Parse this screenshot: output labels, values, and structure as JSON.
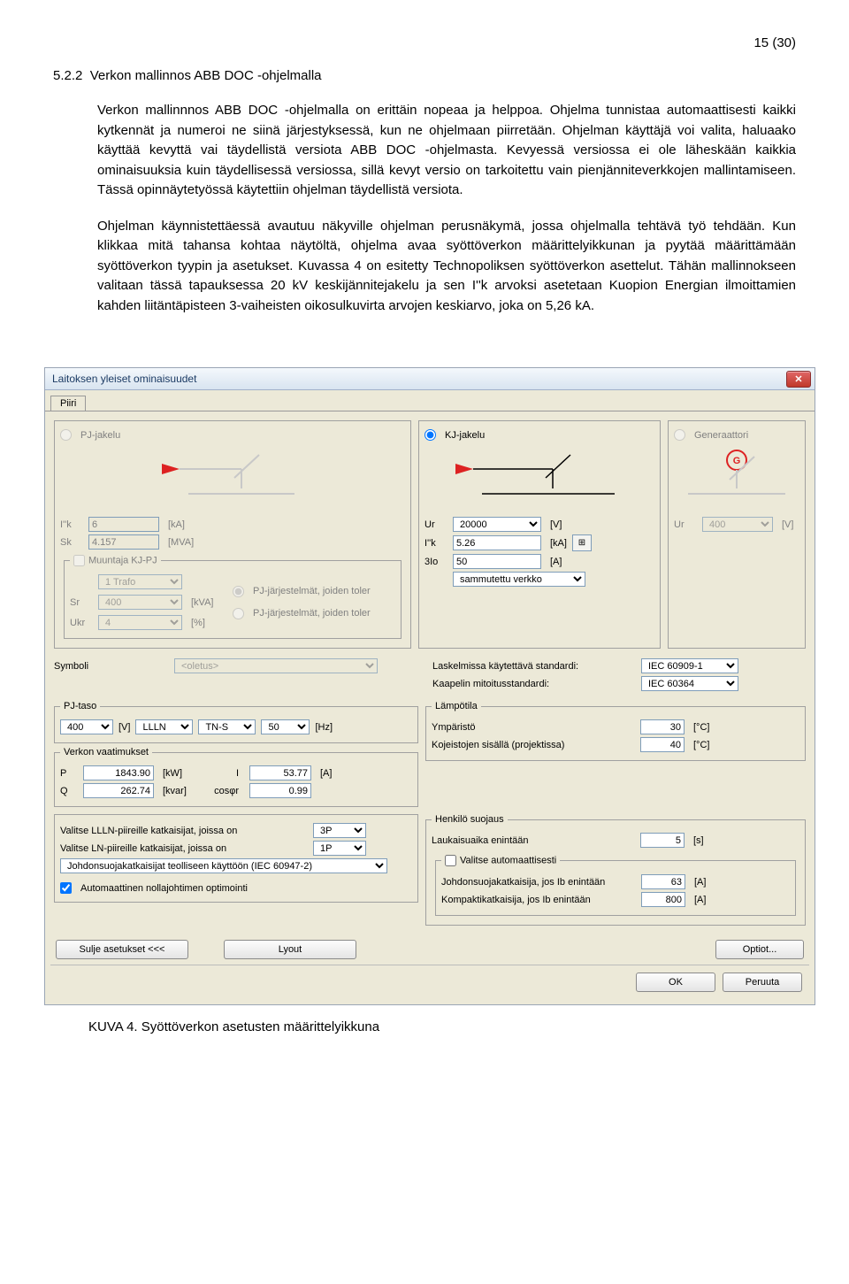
{
  "page": {
    "page_number": "15 (30)",
    "section_number": "5.2.2",
    "section_title": "Verkon mallinnos ABB DOC -ohjelmalla",
    "paragraphs": [
      "Verkon mallinnnos ABB DOC -ohjelmalla on erittäin nopeaa ja helppoa. Ohjelma tunnistaa automaattisesti kaikki kytkennät ja numeroi ne siinä järjestyksessä, kun ne ohjelmaan piirretään. Ohjelman käyttäjä voi valita, haluaako käyttää kevyttä vai täydellistä versiota ABB DOC -ohjelmasta. Kevyessä versiossa ei ole läheskään kaikkia ominaisuuksia kuin täydellisessä versiossa, sillä kevyt versio on tarkoitettu vain pienjänniteverkkojen mallintamiseen. Tässä opinnäytetyössä käytettiin ohjelman täydellistä versiota.",
      "Ohjelman käynnistettäessä avautuu näkyville ohjelman perusnäkymä, jossa ohjelmalla tehtävä työ tehdään. Kun klikkaa mitä tahansa kohtaa näytöltä, ohjelma avaa syöttöverkon määrittelyikkunan ja pyytää määrittämään syöttöverkon tyypin ja asetukset. Kuvassa 4 on esitetty Technopoliksen syöttöverkon asettelut. Tähän mallinnokseen valitaan tässä tapauksessa 20 kV keskijännitejakelu ja sen I''k arvoksi asetetaan Kuopion Energian ilmoittamien kahden liitäntäpisteen 3-vaiheisten oikosulkuvirta arvojen keskiarvo, joka on 5,26 kA."
    ],
    "caption": "KUVA 4. Syöttöverkon asetusten määrittelyikkuna"
  },
  "dialog": {
    "title": "Laitoksen yleiset ominaisuudet",
    "tab": "Piiri",
    "source": {
      "pj_label": "PJ-jakelu",
      "kj_label": "KJ-jakelu",
      "gen_label": "Generaattori",
      "gen_symbol": "G"
    },
    "pj_group": {
      "iik_label": "I''k",
      "iik_value": "6",
      "iik_unit": "[kA]",
      "sk_label": "Sk",
      "sk_value": "4.157",
      "sk_unit": "[MVA]",
      "trafo_legend": "Muuntaja KJ-PJ",
      "trafo_count": "1 Trafo",
      "sr_label": "Sr",
      "sr_value": "400",
      "sr_unit": "[kVA]",
      "ukr_label": "Ukr",
      "ukr_value": "4",
      "ukr_unit": "[%]",
      "pj_opt1": "PJ-järjestelmät, joiden toler",
      "pj_opt2": "PJ-järjestelmät, joiden toler"
    },
    "kj_group": {
      "ur_label": "Ur",
      "ur_value": "20000",
      "ur_unit": "[V]",
      "iik_label": "I''k",
      "iik_value": "5.26",
      "iik_unit": "[kA]",
      "io3_label": "3Io",
      "io3_value": "50",
      "io3_unit": "[A]",
      "ntype_value": "sammutettu verkko"
    },
    "gen_group": {
      "ur_label": "Ur",
      "ur_value": "400",
      "ur_unit": "[V]"
    },
    "symboli": {
      "label": "Symboli",
      "value": "<oletus>"
    },
    "standards": {
      "calc_label": "Laskelmissa käytettävä standardi:",
      "calc_value": "IEC 60909-1",
      "cable_label": "Kaapelin mitoitusstandardi:",
      "cable_value": "IEC 60364"
    },
    "pjtaso": {
      "legend": "PJ-taso",
      "voltage": "400",
      "v_unit": "[V]",
      "phases": "LLLN",
      "earth": "TN-S",
      "freq": "50",
      "freq_unit": "[Hz]"
    },
    "verkon": {
      "legend": "Verkon vaatimukset",
      "p_label": "P",
      "p_value": "1843.90",
      "p_unit": "[kW]",
      "i_label": "I",
      "i_value": "53.77",
      "i_unit": "[A]",
      "q_label": "Q",
      "q_value": "262.74",
      "q_unit": "[kvar]",
      "cos_label": "cosφr",
      "cos_value": "0.99"
    },
    "lampotila": {
      "legend": "Lämpötila",
      "ymp_label": "Ympäristö",
      "ymp_value": "30",
      "unit": "[°C]",
      "koj_label": "Kojeistojen sisällä (projektissa)",
      "koj_value": "40"
    },
    "breakers": {
      "llln_label": "Valitse LLLN-piireille katkaisijat, joissa on",
      "llln_value": "3P",
      "ln_label": "Valitse LN-piireille katkaisijat, joissa on",
      "ln_value": "1P",
      "app_value": "Johdonsuojakatkaisijat teolliseen käyttöön (IEC 60947-2)",
      "auto_opt": "Automaattinen nollajohtimen optimointi"
    },
    "henkilo": {
      "legend": "Henkilö suojaus",
      "trip_label": "Laukaisuaika enintään",
      "trip_value": "5",
      "trip_unit": "[s]",
      "auto_legend": "Valitse automaattisesti",
      "mcb_label": "Johdonsuojakatkaisija, jos Ib enintään",
      "mcb_value": "63",
      "mcb_unit": "[A]",
      "mccb_label": "Kompaktikatkaisija, jos Ib enintään",
      "mccb_value": "800",
      "mccb_unit": "[A]"
    },
    "buttons": {
      "close_settings": "Sulje asetukset <<<",
      "layout": "Lyout",
      "options": "Optiot...",
      "ok": "OK",
      "cancel": "Peruuta"
    }
  }
}
